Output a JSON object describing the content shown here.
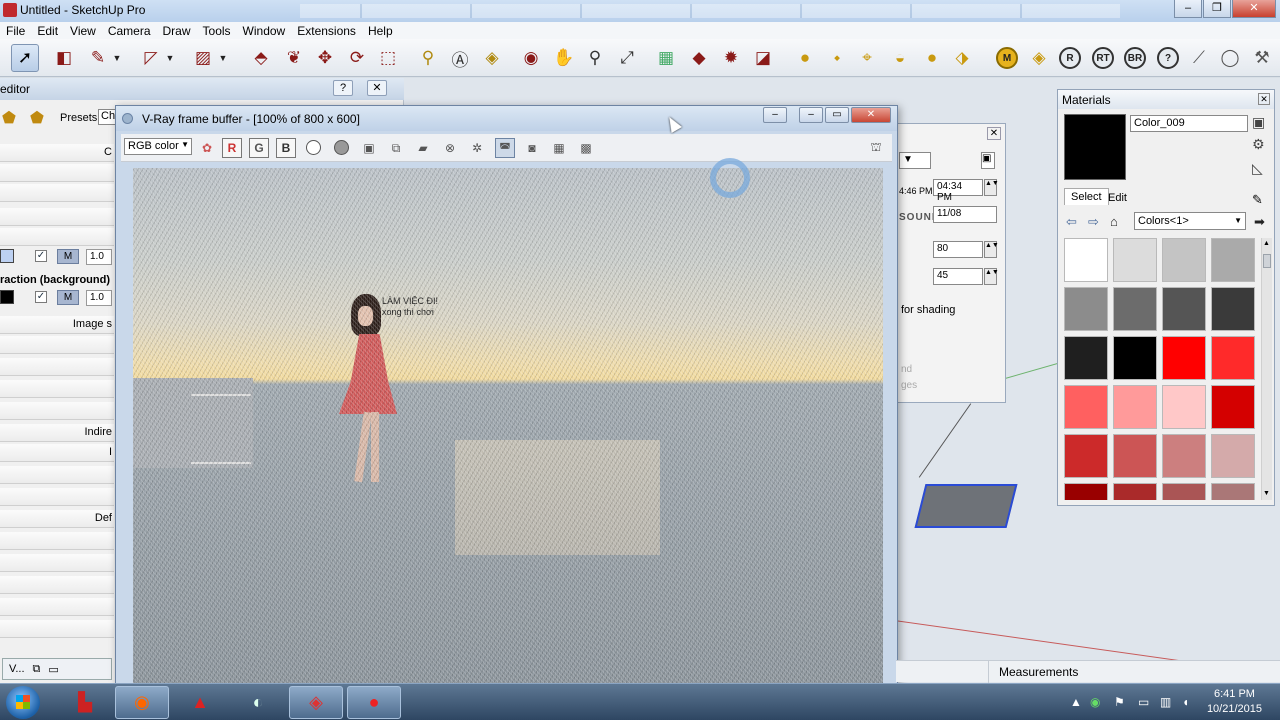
{
  "window": {
    "title": "Untitled - SketchUp Pro"
  },
  "menu": [
    "File",
    "Edit",
    "View",
    "Camera",
    "Draw",
    "Tools",
    "Window",
    "Extensions",
    "Help"
  ],
  "editor": {
    "title": "editor",
    "presets_label": "Presets:",
    "presets_value": "Ch",
    "rows": [
      {
        "label": ""
      },
      {
        "label": ""
      },
      {
        "label": ""
      },
      {
        "label": ""
      }
    ],
    "first_value": "1.0",
    "second_value": "1.0",
    "m_label": "M",
    "checkmark": "✓",
    "refraction_label": "raction (background)",
    "image_label": "Image s",
    "indirect_label": "Indire",
    "i_label": "I",
    "default_label": "Def",
    "bottom_tab": "V..."
  },
  "sun": {
    "time": "04:34 PM",
    "date": "11/08",
    "small_time": "4:46 PM",
    "sound_label": "SOUND",
    "light_value": "80",
    "dark_value": "45",
    "shading_label": "for shading",
    "faded_1": "nd",
    "faded_2": "ges"
  },
  "vfb": {
    "title": "V-Ray frame buffer - [100% of 800 x 600]",
    "color_mode": "RGB color",
    "ch_r": "R",
    "ch_g": "G",
    "ch_b": "B",
    "caption_line1": "LÀM VIỆC ĐI!",
    "caption_line2": "xong thì chơi"
  },
  "materials": {
    "title": "Materials",
    "name": "Color_009",
    "tab_select": "Select",
    "tab_edit": "Edit",
    "library": "Colors<1>",
    "swatches": [
      "#ffffff",
      "#dcdcdc",
      "#c4c4c4",
      "#aaaaaa",
      "#8c8c8c",
      "#6c6c6c",
      "#555555",
      "#3a3a3a",
      "#1f1f1f",
      "#000000",
      "#ff0000",
      "#ff2a2a",
      "#ff6060",
      "#ff9a9a",
      "#ffc8c8",
      "#d40000",
      "#cc2a2a",
      "#cc5555",
      "#cc7f7f",
      "#d4aaaa",
      "#990000",
      "#aa2a2a",
      "#aa5555",
      "#aa7777"
    ]
  },
  "status": {
    "measurements": "Measurements"
  },
  "taskbar": {
    "time": "6:41 PM",
    "date": "10/21/2015",
    "apps": [
      "sketchup-icon",
      "firefox-icon",
      "autocad-icon",
      "browser-icon",
      "sketchup-pro-icon",
      "record-icon"
    ]
  }
}
